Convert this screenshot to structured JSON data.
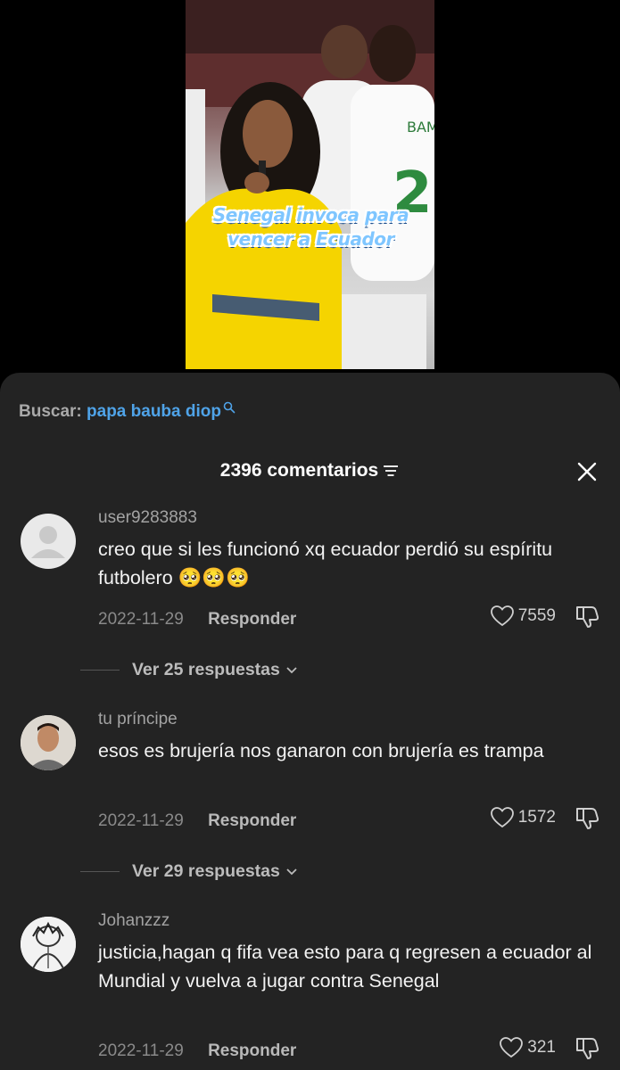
{
  "video": {
    "caption": "Senegal invoca para vencer a Ecuador",
    "jersey_text": "BAMB"
  },
  "search": {
    "label": "Buscar:",
    "query": "papa bauba diop"
  },
  "header": {
    "count_label": "2396 comentarios"
  },
  "comments": [
    {
      "username": "user9283883",
      "text": "creo que si les funcionó xq ecuador perdió su espíritu futbolero 🥺🥺🥺",
      "date": "2022-11-29",
      "reply_label": "Responder",
      "likes": "7559",
      "replies_label": "Ver 25 respuestas"
    },
    {
      "username": "tu príncipe",
      "text": "esos es brujería nos ganaron con brujería es trampa",
      "date": "2022-11-29",
      "reply_label": "Responder",
      "likes": "1572",
      "replies_label": "Ver 29 respuestas"
    },
    {
      "username": "Johanzzz",
      "text": "justicia,hagan q fifa vea esto para q regresen a ecuador al Mundial y vuelva a jugar contra Senegal",
      "date": "2022-11-29",
      "reply_label": "Responder",
      "likes": "321"
    }
  ],
  "colors": {
    "panel_bg": "#232323",
    "search_query": "#4fa3e8",
    "caption": "#7fc6ff"
  },
  "icons": {
    "search": "search-icon",
    "sort": "sort-icon",
    "close": "close-icon",
    "like": "heart-icon",
    "dislike": "dislike-icon",
    "expand": "chevron-down-icon"
  }
}
